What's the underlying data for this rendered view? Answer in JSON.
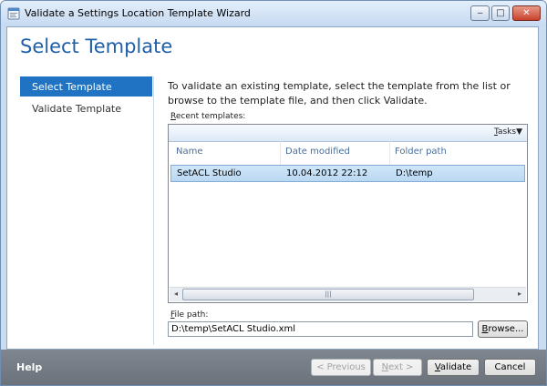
{
  "window": {
    "title": "Validate a Settings Location Template Wizard",
    "controls": {
      "minimize": "‒",
      "maximize": "□",
      "close": "✕"
    },
    "icon": "wizard-icon"
  },
  "page": {
    "title": "Select Template"
  },
  "steps": [
    {
      "label": "Select Template",
      "active": true
    },
    {
      "label": "Validate Template",
      "active": false
    }
  ],
  "instructions": "To validate an existing template, select the template from the list or browse to the template file, and then click Validate.",
  "recent": {
    "label_key": "R",
    "label_rest": "ecent templates:",
    "tasks_key": "T",
    "tasks_rest": "asks",
    "tasks_arrow": "▼",
    "columns": [
      "Name",
      "Date modified",
      "Folder path"
    ],
    "rows": [
      {
        "name": "SetACL Studio",
        "date": "10.04.2012 22:12",
        "folder": "D:\\temp",
        "selected": true
      }
    ],
    "scroll_left": "◂",
    "scroll_right": "▸",
    "scroll_grip": "|||"
  },
  "file_path": {
    "label_key": "F",
    "label_rest": "ile path:",
    "value": "D:\\temp\\SetACL Studio.xml",
    "browse_key": "B",
    "browse_rest": "rowse..."
  },
  "footer": {
    "help": "Help",
    "previous": "< Previous",
    "next_key": "N",
    "next_rest": "ext >",
    "validate_key": "V",
    "validate_rest": "alidate",
    "cancel": "Cancel"
  },
  "colors": {
    "accent": "#1f73c2",
    "title": "#1f5fa8",
    "footer": "#737a83",
    "selection": "#c7e0f5"
  }
}
